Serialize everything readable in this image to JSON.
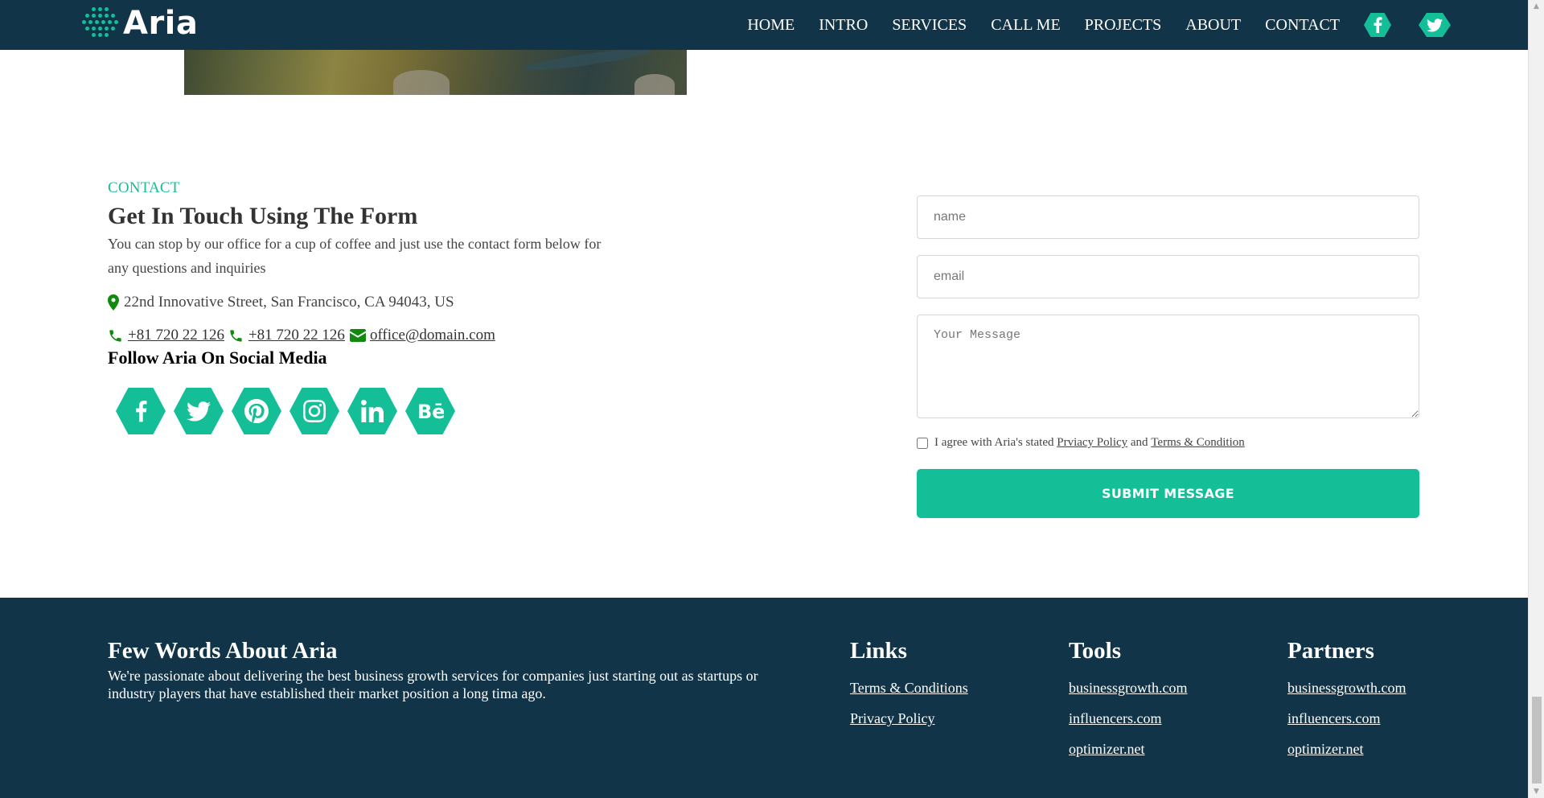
{
  "nav": {
    "logo_text": "Aria",
    "links": [
      "HOME",
      "INTRO",
      "SERVICES",
      "CALL ME",
      "PROJECTS",
      "ABOUT",
      "CONTACT"
    ],
    "icons": [
      "facebook-icon",
      "twitter-icon"
    ]
  },
  "contact": {
    "tag": "CONTACT",
    "heading": "Get In Touch Using The Form",
    "description": "You can stop by our office for a cup of coffee and just use the contact form below for any questions and inquiries",
    "address": "22nd Innovative Street, San Francisco, CA 94043, US",
    "phone1": "+81 720 22 126",
    "phone2": "+81 720 22 126",
    "email": "office@domain.com",
    "follow_heading": "Follow Aria On Social Media",
    "social_icons": [
      "facebook-icon",
      "twitter-icon",
      "pinterest-icon",
      "instagram-icon",
      "linkedin-icon",
      "behance-icon"
    ]
  },
  "form": {
    "name_placeholder": "name",
    "email_placeholder": "email",
    "message_placeholder": "Your Message",
    "agree_prefix": "I agree with Aria's stated",
    "privacy_link": "Prviacy Policy",
    "agree_and": "and",
    "terms_link": "Terms & Condition",
    "submit_label": "SUBMIT MESSAGE"
  },
  "footer": {
    "about_heading": "Few Words About Aria",
    "about_text": "We're passionate about delivering the best business growth services for companies just starting out as startups or industry players that have established their market position a long tima ago.",
    "links_heading": "Links",
    "links": [
      "Terms & Conditions",
      "Privacy Policy"
    ],
    "tools_heading": "Tools",
    "tools": [
      "businessgrowth.com",
      "influencers.com",
      "optimizer.net"
    ],
    "partners_heading": "Partners",
    "partners": [
      "businessgrowth.com",
      "influencers.com",
      "optimizer.net"
    ]
  },
  "colors": {
    "navy": "#113448",
    "accent": "#14bf98",
    "icon_green": "#0f8a0f"
  }
}
